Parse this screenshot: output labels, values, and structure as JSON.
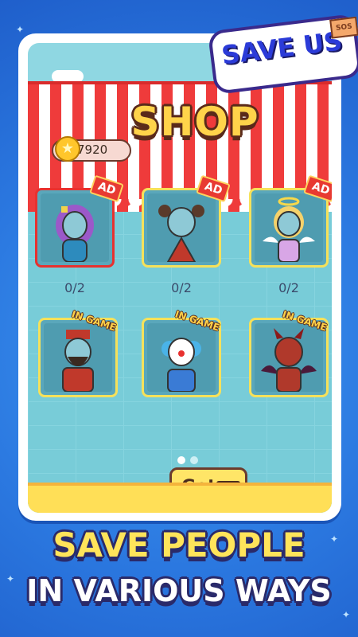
{
  "logo": {
    "text": "SAVE US",
    "sign": "SOS"
  },
  "shop": {
    "title": "SHOP",
    "coins": "7920",
    "cards": [
      {
        "tag": "AD",
        "count": "0/2",
        "character": "purple-hair-girl",
        "selected": true
      },
      {
        "tag": "AD",
        "count": "0/2",
        "character": "pigtail-girl",
        "selected": false
      },
      {
        "tag": "AD",
        "count": "0/2",
        "character": "angel",
        "selected": false
      },
      {
        "tag": "IN GAME",
        "character": "bearded-king",
        "selected": false
      },
      {
        "tag": "IN GAME",
        "character": "clown",
        "selected": false
      },
      {
        "tag": "IN GAME",
        "character": "devil",
        "selected": false
      }
    ],
    "page_count": 2,
    "current_page": 1,
    "get_label": "Get",
    "get_ad_label": "AD"
  },
  "tagline": {
    "line1": "SAVE PEOPLE",
    "line2": "IN VARIOUS WAYS"
  },
  "colors": {
    "background": "#2b78e0",
    "awning_red": "#ef3b3b",
    "button": "#ffe567",
    "tagline_yellow": "#ffe45a"
  }
}
